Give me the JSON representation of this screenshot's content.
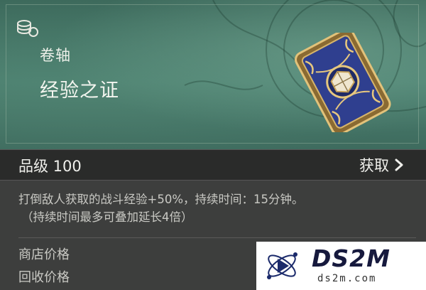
{
  "item": {
    "category": "卷轴",
    "name": "经验之证"
  },
  "grade": {
    "label": "品级 100",
    "acquire_label": "获取"
  },
  "description": {
    "line1": "打倒敌人获取的战斗经验+50%，持续时间：15分钟。",
    "line2": "（持续时间最多可叠加延长4倍）"
  },
  "prices": {
    "shop": "商店价格",
    "recycle": "回收价格"
  },
  "watermark": {
    "title": "DS2M",
    "subtitle": "ds2m.com"
  },
  "icons": {
    "type_icon": "coins-icon",
    "acquire_chevron": "chevron-right-icon",
    "card_art": "scroll-card-icon"
  },
  "colors": {
    "header_teal": "#4b8070",
    "bar_dark": "#2a2b2a",
    "text_light": "#f0f0ec",
    "gold": "#c9a45a",
    "card_blue": "#2f3f8f"
  }
}
